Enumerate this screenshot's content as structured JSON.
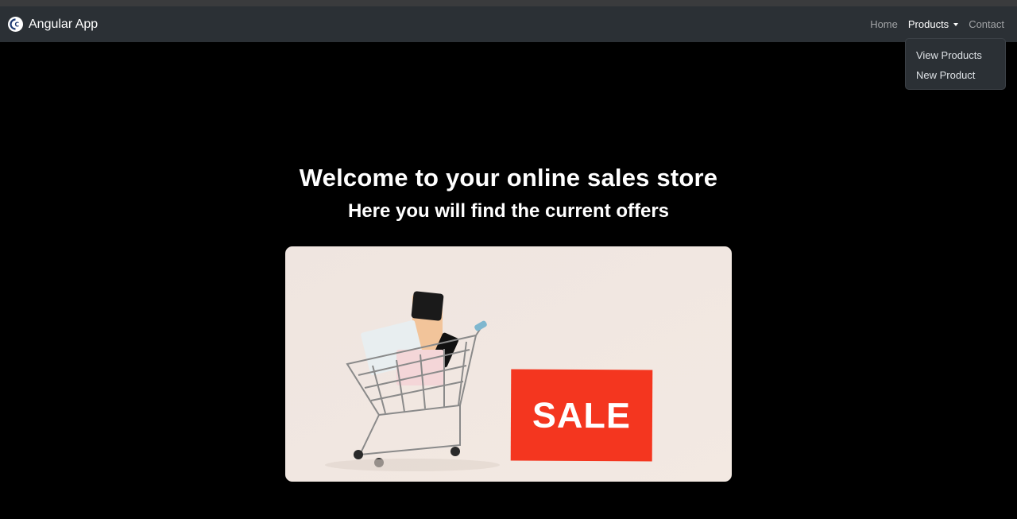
{
  "navbar": {
    "brand": "Angular App",
    "links": [
      {
        "label": "Home"
      },
      {
        "label": "Products"
      },
      {
        "label": "Contact"
      }
    ],
    "dropdown": [
      {
        "label": "View Products"
      },
      {
        "label": "New Product"
      }
    ]
  },
  "hero": {
    "title": "Welcome to your online sales store",
    "subtitle": "Here you will find the current offers",
    "banner": {
      "tag_text": "SALE",
      "tag_color": "#f4361f",
      "background_color": "#f0e6df"
    }
  },
  "icons": {
    "brand": "logo-icon",
    "products_caret": "caret-down-icon"
  }
}
